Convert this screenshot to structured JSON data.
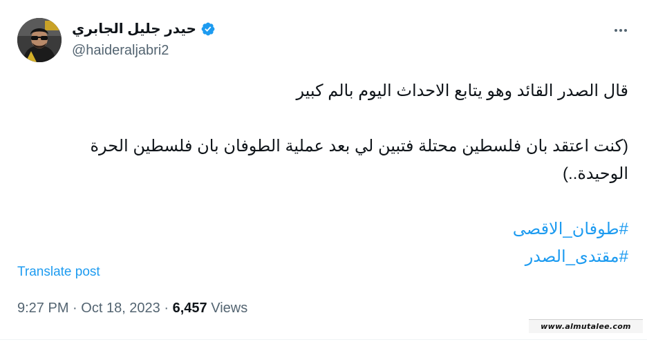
{
  "author": {
    "display_name": "حيدر جليل الجابري",
    "handle": "@haideraljabri2",
    "verified": true
  },
  "tweet": {
    "paragraphs": [
      "قال الصدر القائد وهو يتابع الاحداث اليوم بالم كبير",
      "(كنت اعتقد بان فلسطين محتلة فتبين لي بعد عملية الطوفان بان فلسطين الحرة الوحيدة..)"
    ],
    "hashtags": [
      "#طوفان_الاقصى",
      "#مقتدى_الصدر"
    ]
  },
  "translate_label": "Translate post",
  "meta": {
    "time": "9:27 PM",
    "separator": "·",
    "date": "Oct 18, 2023",
    "views_count": "6,457",
    "views_label": "Views"
  },
  "watermark": "www.almutalee.com",
  "colors": {
    "accent": "#1d9bf0",
    "text": "#0f1419",
    "secondary": "#536471"
  },
  "icons": [
    "verified-badge-icon",
    "more-options-icon"
  ]
}
